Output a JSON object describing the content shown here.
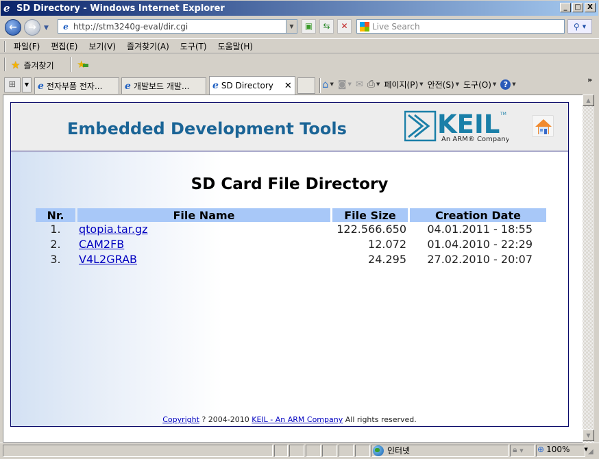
{
  "window": {
    "title": "SD Directory - Windows Internet Explorer",
    "controls": {
      "minimize": "_",
      "maximize": "□",
      "close": "X"
    }
  },
  "address_bar": {
    "url": "http://stm3240g-eval/dir.cgi",
    "search_placeholder": "Live Search"
  },
  "menu": {
    "items": [
      "파일(F)",
      "편집(E)",
      "보기(V)",
      "즐겨찾기(A)",
      "도구(T)",
      "도움말(H)"
    ]
  },
  "favorites_bar": {
    "favorites_label": "즐겨찾기"
  },
  "tabs": [
    {
      "label": "전자부품 전자...",
      "active": false
    },
    {
      "label": "개발보드 개발...",
      "active": false
    },
    {
      "label": "SD Directory",
      "active": true
    }
  ],
  "command_bar": {
    "page_label": "페이지(P)",
    "safety_label": "안전(S)",
    "tools_label": "도구(O)",
    "more": "»"
  },
  "page": {
    "header_title": "Embedded Development Tools",
    "logo_text": "KEIL",
    "logo_tm": "TM",
    "logo_tagline": "An ARM® Company",
    "heading": "SD Card File Directory",
    "table": {
      "columns": [
        "Nr.",
        "File Name",
        "File Size",
        "Creation Date"
      ],
      "rows": [
        {
          "nr": "1.",
          "name": "qtopia.tar.gz",
          "size": "122.566.650",
          "date": "04.01.2011 - 18:55"
        },
        {
          "nr": "2.",
          "name": "CAM2FB",
          "size": "12.072",
          "date": "01.04.2010 - 22:29"
        },
        {
          "nr": "3.",
          "name": "V4L2GRAB",
          "size": "24.295",
          "date": "27.02.2010 - 20:07"
        }
      ]
    },
    "footer": {
      "copyright_link": "Copyright",
      "years": "? 2004-2010",
      "company_link": "KEIL - An ARM Company",
      "rights": "All rights reserved."
    }
  },
  "status_bar": {
    "zone": "인터넷",
    "zoom": "100%"
  },
  "colors": {
    "header_title": "#1a6496",
    "table_header_bg": "#a8c8f8",
    "link": "#0000c0",
    "keil_brand": "#1a7fa8"
  }
}
